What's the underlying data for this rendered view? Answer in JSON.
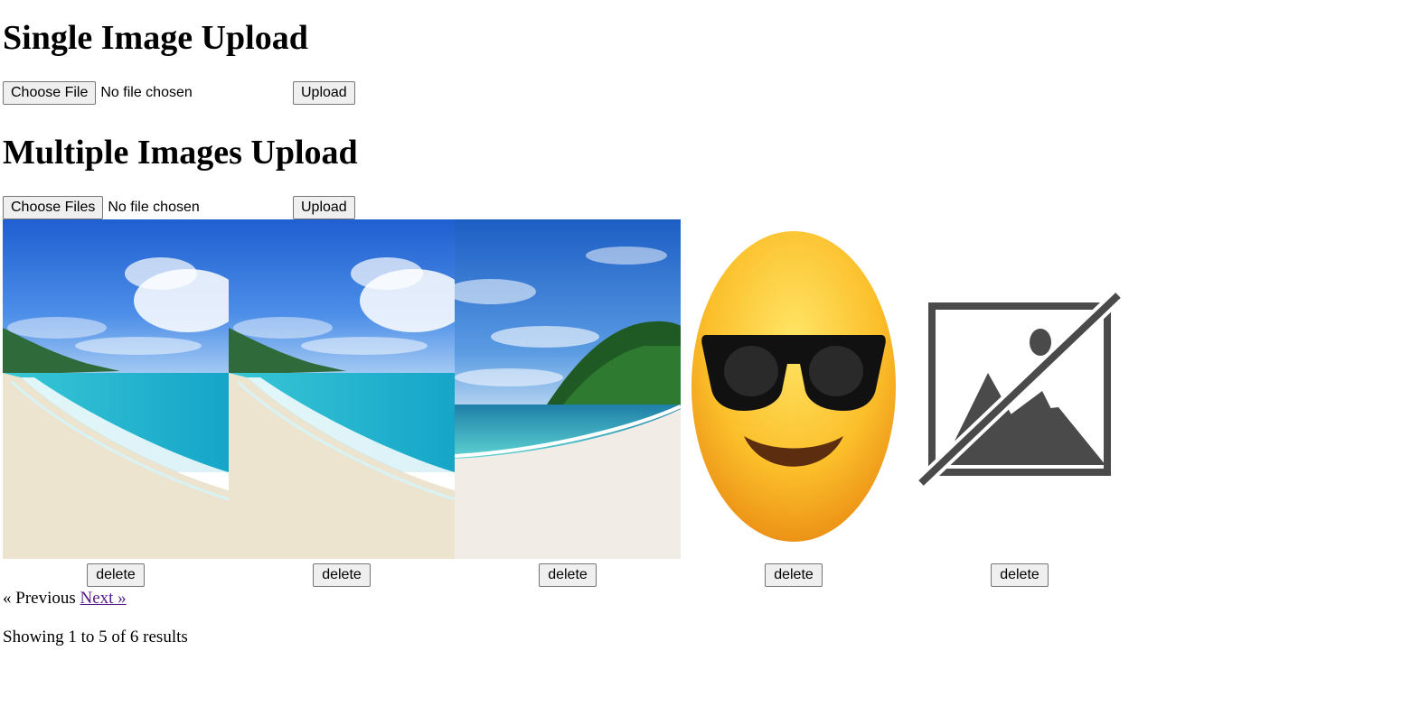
{
  "single_upload": {
    "heading": "Single Image Upload",
    "choose_label": "Choose File",
    "status": "No file chosen",
    "upload_label": "Upload"
  },
  "multiple_upload": {
    "heading": "Multiple Images Upload",
    "choose_label": "Choose Files",
    "status": "No file chosen",
    "upload_label": "Upload"
  },
  "gallery": {
    "items": [
      {
        "image": "beach-photo",
        "delete_label": "delete"
      },
      {
        "image": "beach-photo",
        "delete_label": "delete"
      },
      {
        "image": "beach-island-photo",
        "delete_label": "delete"
      },
      {
        "image": "sunglasses-emoji",
        "delete_label": "delete"
      },
      {
        "image": "broken-image-icon",
        "delete_label": "delete"
      }
    ]
  },
  "pagination": {
    "previous": "« Previous",
    "next": "Next »",
    "summary": "Showing 1 to 5 of 6 results"
  },
  "colors": {
    "link": "#551a8b",
    "button_bg": "#efefef",
    "button_border": "#767676",
    "placeholder_icon": "#4a4a4a"
  }
}
